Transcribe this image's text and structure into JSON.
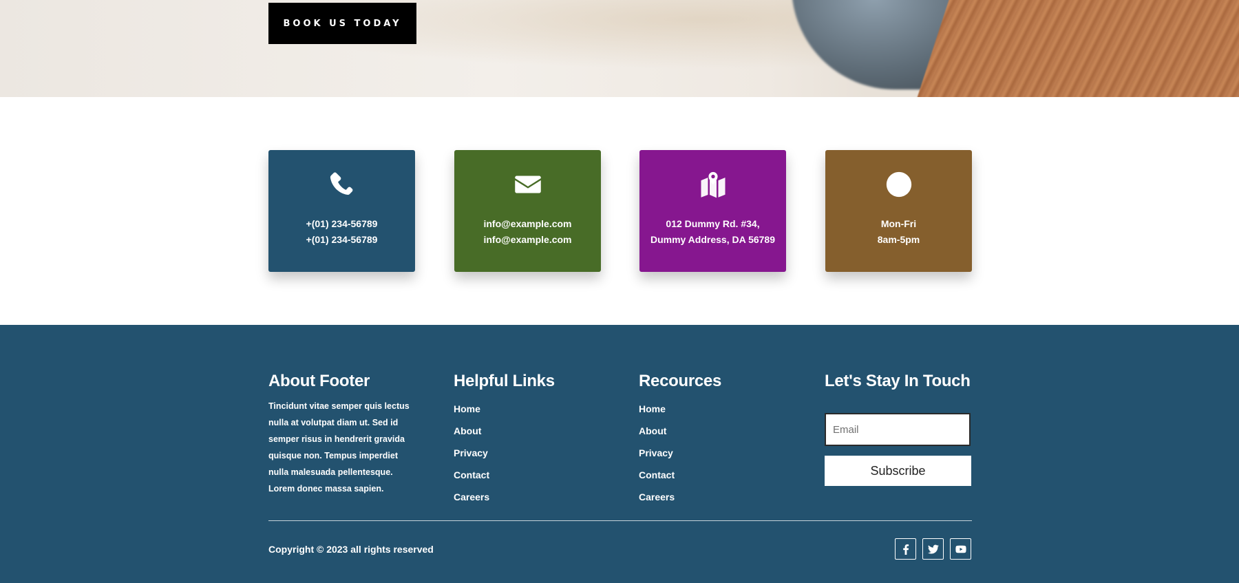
{
  "hero": {
    "cta_label": "BOOK US TODAY"
  },
  "contact_cards": [
    {
      "icon": "phone-icon",
      "color": "#23526f",
      "lines": [
        "+(01) 234-56789",
        "+(01) 234-56789"
      ]
    },
    {
      "icon": "envelope-icon",
      "color": "#486c27",
      "lines": [
        "info@example.com",
        "info@example.com"
      ]
    },
    {
      "icon": "map-marker-icon",
      "color": "#86178f",
      "lines": [
        "012 Dummy Rd. #34,",
        "Dummy Address, DA 56789"
      ]
    },
    {
      "icon": "clock-icon",
      "color": "#855f2d",
      "lines": [
        "Mon-Fri",
        "8am-5pm"
      ]
    }
  ],
  "footer": {
    "background": "#23526f",
    "about": {
      "title": "About Footer",
      "text": "Tincidunt vitae semper quis lectus nulla at volutpat diam ut. Sed id semper risus in hendrerit gravida quisque non. Tempus imperdiet nulla malesuada pellentesque. Lorem donec massa sapien."
    },
    "helpful_links": {
      "title": "Helpful Links",
      "items": [
        "Home",
        "About",
        "Privacy",
        "Contact",
        "Careers"
      ]
    },
    "resources": {
      "title": "Recources",
      "items": [
        "Home",
        "About",
        "Privacy",
        "Contact",
        "Careers"
      ]
    },
    "newsletter": {
      "title": "Let's Stay In Touch",
      "email_placeholder": "Email",
      "subscribe_label": "Subscribe"
    },
    "copyright": "Copyright © 2023 all rights reserved",
    "social": [
      "facebook-icon",
      "twitter-icon",
      "youtube-icon"
    ]
  }
}
